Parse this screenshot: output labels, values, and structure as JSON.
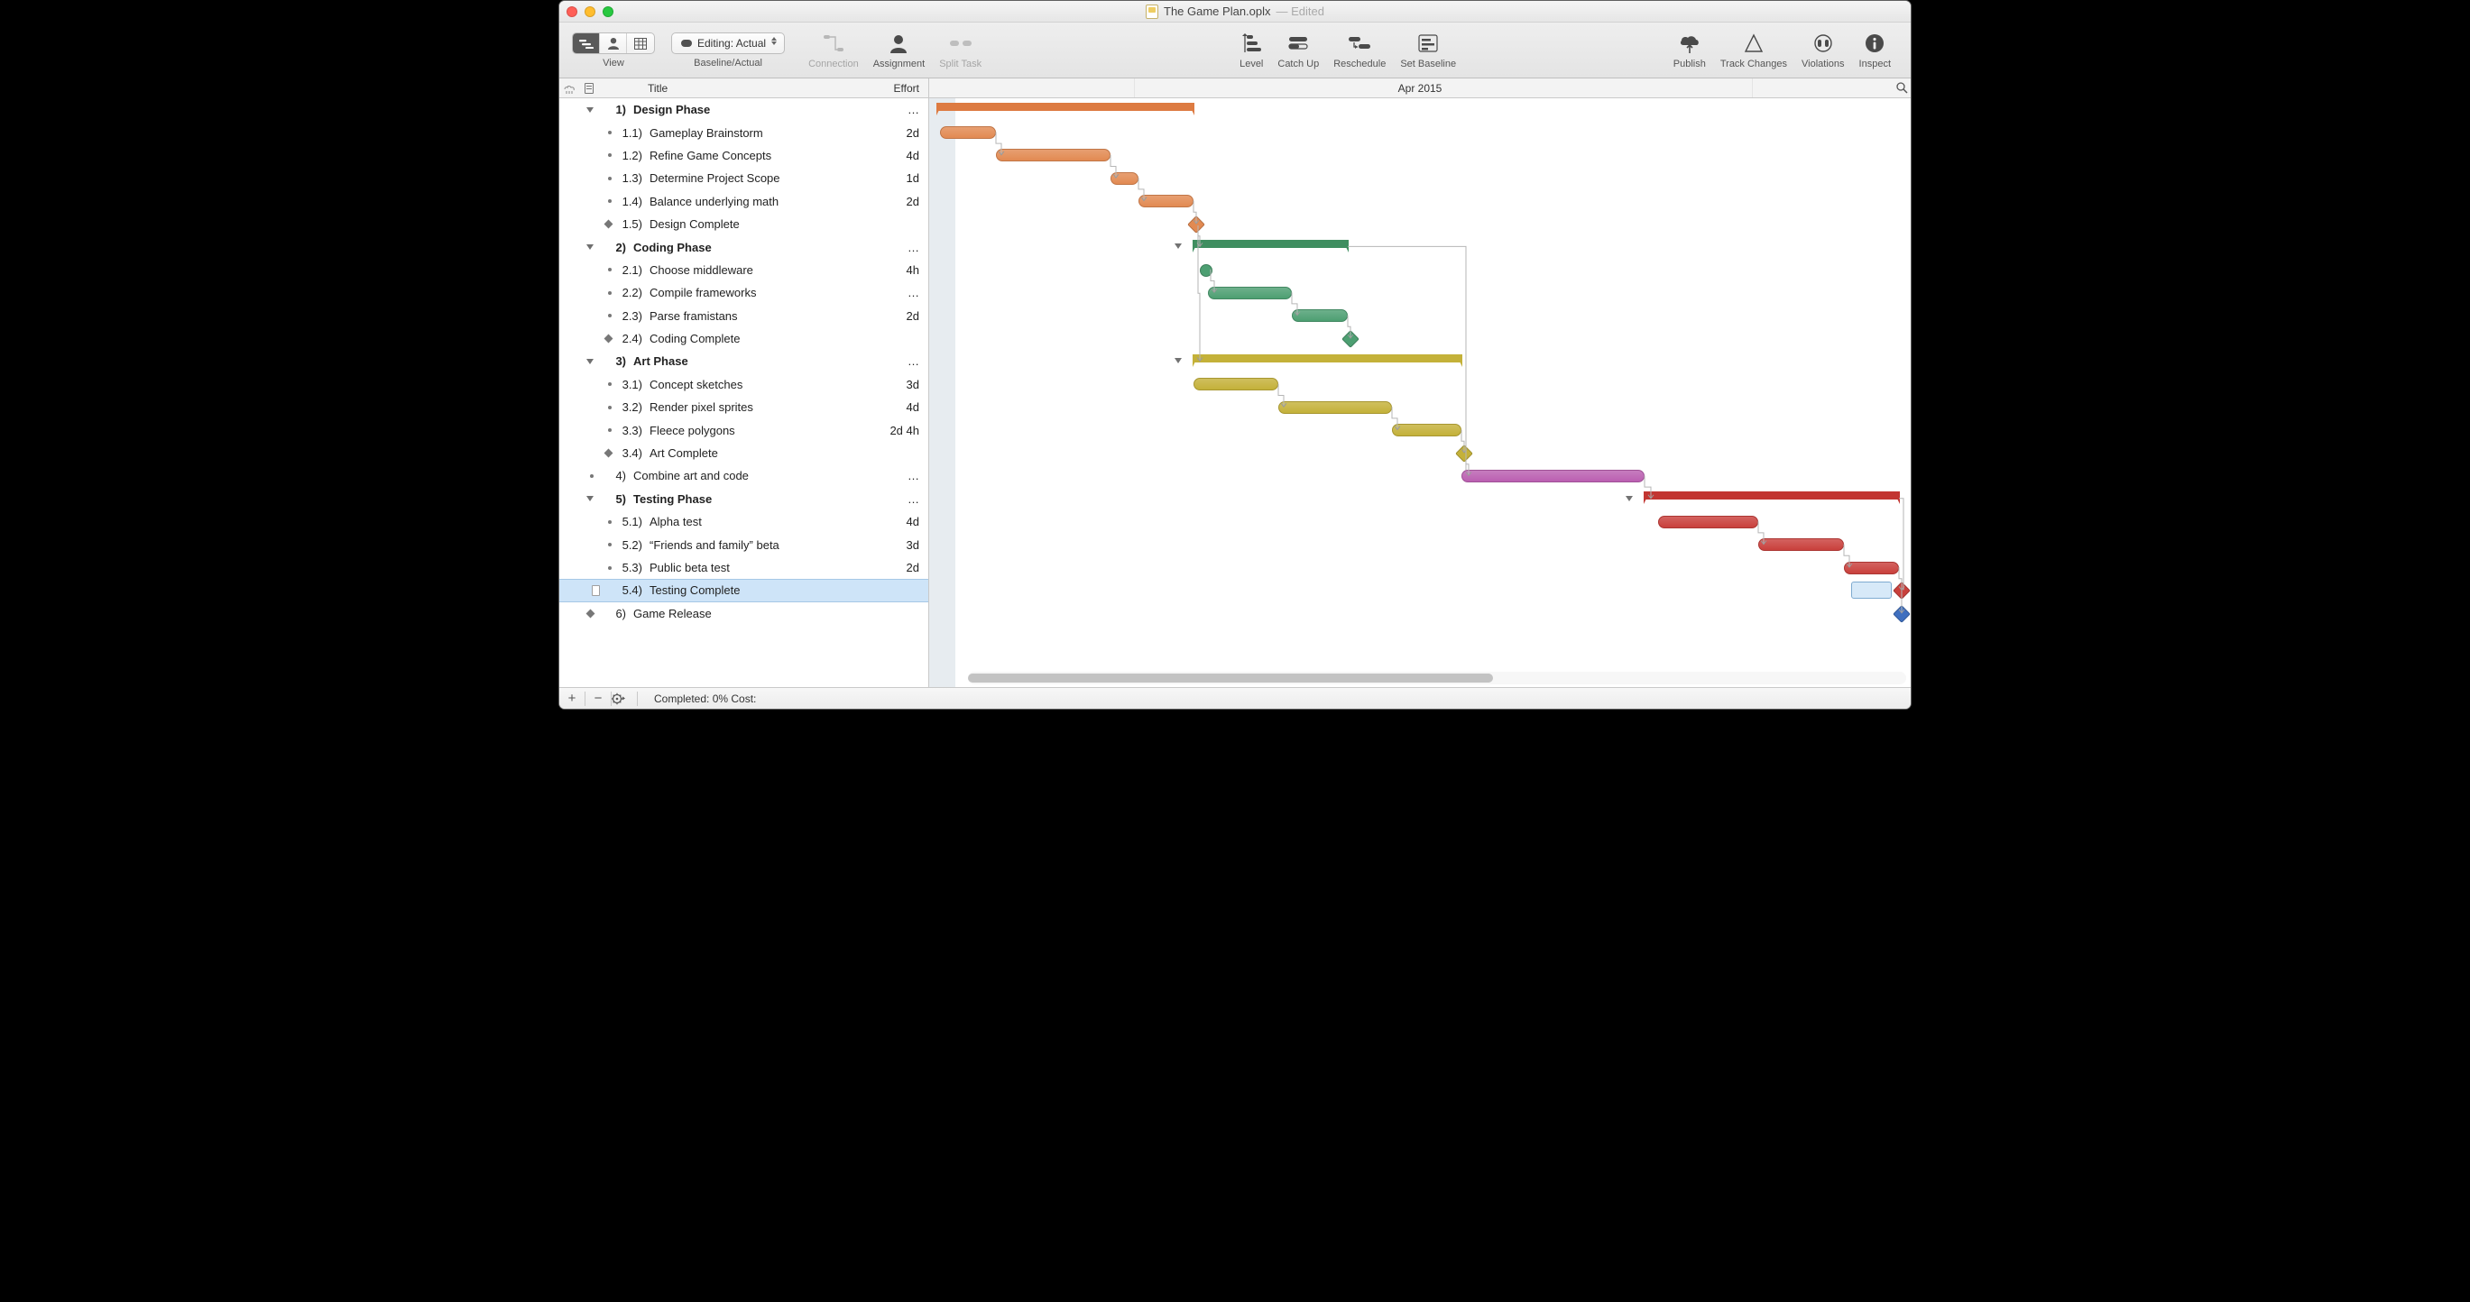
{
  "window": {
    "filename": "The Game Plan.oplx",
    "edited_suffix": "— Edited"
  },
  "toolbar": {
    "view_label": "View",
    "baseline_dropdown": "Editing: Actual",
    "baseline_label": "Baseline/Actual",
    "connection": "Connection",
    "assignment": "Assignment",
    "split_task": "Split Task",
    "level": "Level",
    "catch_up": "Catch Up",
    "reschedule": "Reschedule",
    "set_baseline": "Set Baseline",
    "publish": "Publish",
    "track_changes": "Track Changes",
    "violations": "Violations",
    "inspect": "Inspect"
  },
  "header": {
    "title_col": "Title",
    "effort_col": "Effort",
    "month": "Apr 2015"
  },
  "statusbar": {
    "text": "Completed: 0% Cost:"
  },
  "colors": {
    "orange": "#e28a52",
    "orange_group": "#dd7b42",
    "green": "#4d9f72",
    "green_group": "#3f8e60",
    "yellow": "#c4b139",
    "yellow_group": "#c4b139",
    "purple": "#bb5fb1",
    "red": "#c9403c",
    "red_group": "#c23531",
    "blue": "#3f6fbf"
  },
  "tasks": [
    {
      "id": "1",
      "num": "1)",
      "title": "Design Phase",
      "effort": "…",
      "type": "group",
      "indent": 0,
      "color": "orange_group",
      "start": 9,
      "end": 293
    },
    {
      "id": "1.1",
      "num": "1.1)",
      "title": "Gameplay Brainstorm",
      "effort": "2d",
      "type": "task",
      "indent": 1,
      "color": "orange",
      "start": 12,
      "end": 74
    },
    {
      "id": "1.2",
      "num": "1.2)",
      "title": "Refine Game Concepts",
      "effort": "4d",
      "type": "task",
      "indent": 1,
      "color": "orange",
      "start": 74,
      "end": 201
    },
    {
      "id": "1.3",
      "num": "1.3)",
      "title": "Determine Project Scope",
      "effort": "1d",
      "type": "task",
      "indent": 1,
      "color": "orange",
      "start": 201,
      "end": 232
    },
    {
      "id": "1.4",
      "num": "1.4)",
      "title": "Balance underlying math",
      "effort": "2d",
      "type": "task",
      "indent": 1,
      "color": "orange",
      "start": 232,
      "end": 293
    },
    {
      "id": "1.5",
      "num": "1.5)",
      "title": "Design Complete",
      "effort": "",
      "type": "milestone",
      "indent": 1,
      "color": "orange",
      "at": 289
    },
    {
      "id": "2",
      "num": "2)",
      "title": "Coding Phase",
      "effort": "…",
      "type": "group",
      "indent": 0,
      "color": "green_group",
      "start": 293,
      "end": 464,
      "expander": 272
    },
    {
      "id": "2.1",
      "num": "2.1)",
      "title": "Choose middleware",
      "effort": "4h",
      "type": "circle",
      "indent": 1,
      "color": "green",
      "at": 300
    },
    {
      "id": "2.2",
      "num": "2.2)",
      "title": "Compile frameworks",
      "effort": "…",
      "type": "task",
      "indent": 1,
      "color": "green",
      "start": 309,
      "end": 402
    },
    {
      "id": "2.3",
      "num": "2.3)",
      "title": "Parse framistans",
      "effort": "2d",
      "type": "task",
      "indent": 1,
      "color": "green",
      "start": 402,
      "end": 464
    },
    {
      "id": "2.4",
      "num": "2.4)",
      "title": "Coding Complete",
      "effort": "",
      "type": "milestone",
      "indent": 1,
      "color": "green",
      "at": 460
    },
    {
      "id": "3",
      "num": "3)",
      "title": "Art Phase",
      "effort": "…",
      "type": "group",
      "indent": 0,
      "color": "yellow_group",
      "start": 293,
      "end": 590,
      "expander": 272
    },
    {
      "id": "3.1",
      "num": "3.1)",
      "title": "Concept sketches",
      "effort": "3d",
      "type": "task",
      "indent": 1,
      "color": "yellow",
      "start": 293,
      "end": 387
    },
    {
      "id": "3.2",
      "num": "3.2)",
      "title": "Render pixel sprites",
      "effort": "4d",
      "type": "task",
      "indent": 1,
      "color": "yellow",
      "start": 387,
      "end": 513
    },
    {
      "id": "3.3",
      "num": "3.3)",
      "title": "Fleece polygons",
      "effort": "2d 4h",
      "type": "task",
      "indent": 1,
      "color": "yellow",
      "start": 513,
      "end": 590
    },
    {
      "id": "3.4",
      "num": "3.4)",
      "title": "Art Complete",
      "effort": "",
      "type": "milestone",
      "indent": 1,
      "color": "yellow",
      "at": 586
    },
    {
      "id": "4",
      "num": "4)",
      "title": "Combine art and code",
      "effort": "…",
      "type": "task",
      "indent": 0,
      "color": "purple",
      "start": 590,
      "end": 793
    },
    {
      "id": "5",
      "num": "5)",
      "title": "Testing Phase",
      "effort": "…",
      "type": "group",
      "indent": 0,
      "color": "red_group",
      "start": 793,
      "end": 1075,
      "expander": 772
    },
    {
      "id": "5.1",
      "num": "5.1)",
      "title": "Alpha test",
      "effort": "4d",
      "type": "task",
      "indent": 1,
      "color": "red",
      "start": 808,
      "end": 919
    },
    {
      "id": "5.2",
      "num": "5.2)",
      "title": "“Friends and family” beta",
      "effort": "3d",
      "type": "task",
      "indent": 1,
      "color": "red",
      "start": 919,
      "end": 1014
    },
    {
      "id": "5.3",
      "num": "5.3)",
      "title": "Public beta test",
      "effort": "2d",
      "type": "task",
      "indent": 1,
      "color": "red",
      "start": 1014,
      "end": 1075
    },
    {
      "id": "5.4",
      "num": "5.4)",
      "title": "Testing Complete",
      "effort": "",
      "type": "milestone",
      "indent": 1,
      "color": "red",
      "at": 1071,
      "selected": true,
      "sel_start": 1022,
      "sel_end": 1067
    },
    {
      "id": "6",
      "num": "6)",
      "title": "Game Release",
      "effort": "",
      "type": "milestone",
      "indent": 0,
      "color": "blue",
      "at": 1071
    }
  ]
}
